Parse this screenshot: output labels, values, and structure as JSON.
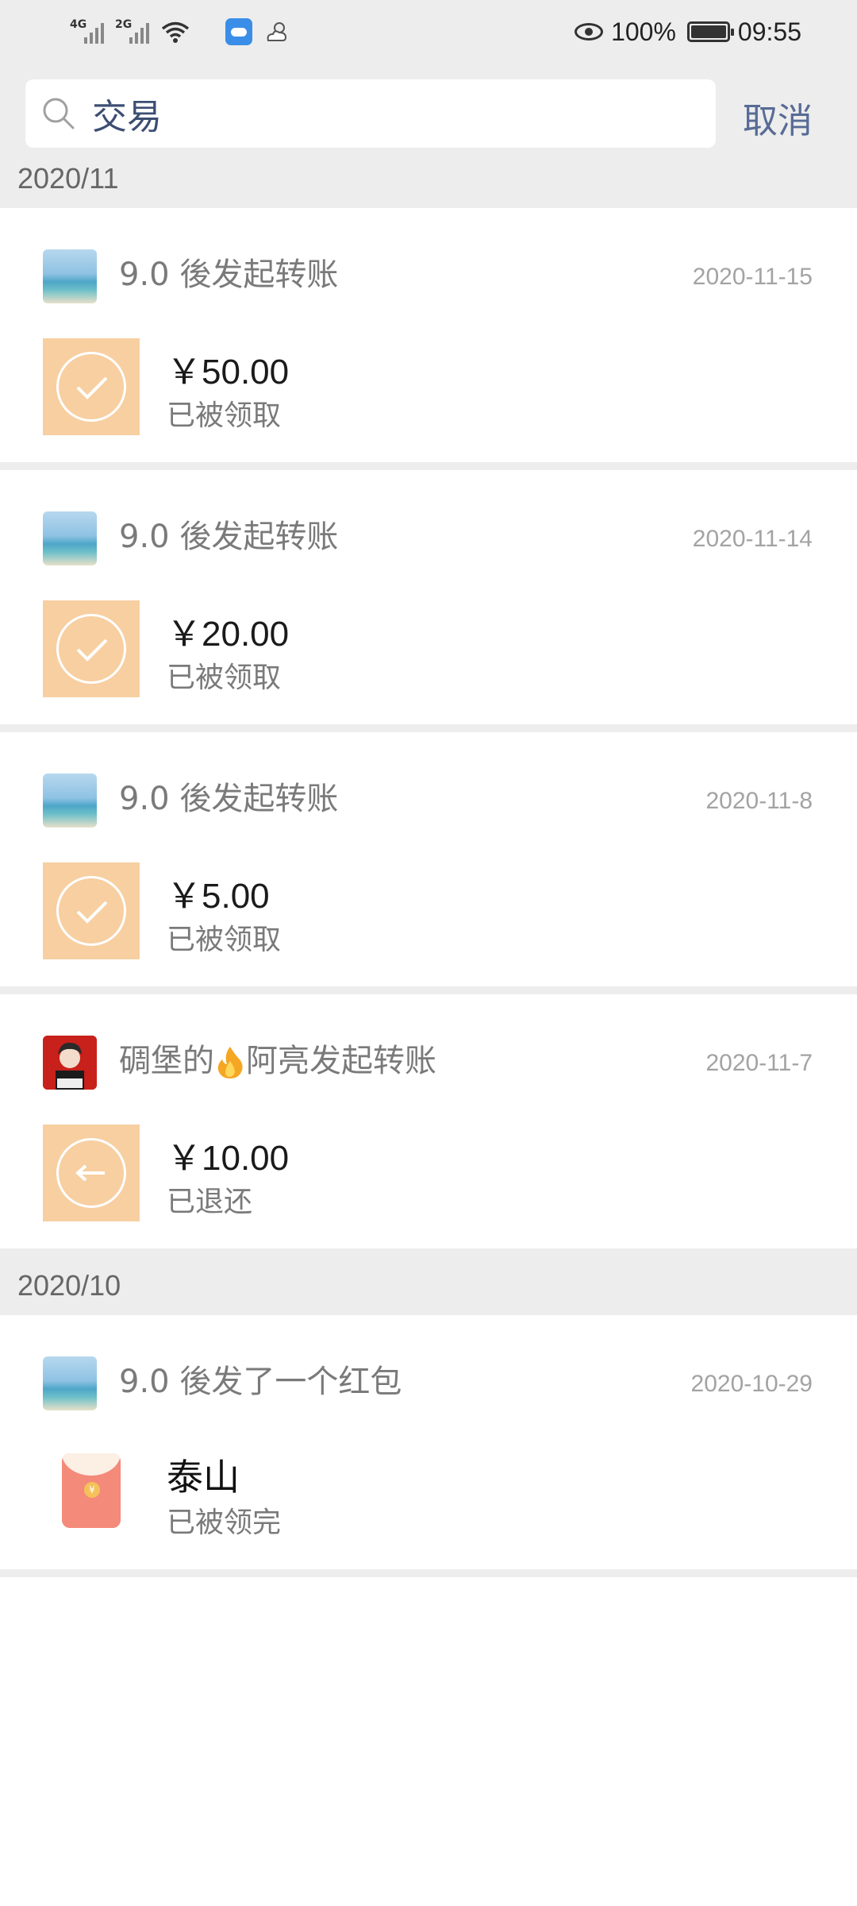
{
  "status_bar": {
    "net1": "4G",
    "net2": "2G",
    "battery_percent": "100%",
    "time": "09:55"
  },
  "search": {
    "query": "交易",
    "cancel_label": "取消"
  },
  "sections": [
    {
      "month": "2020/11",
      "items": [
        {
          "sender": "9.0 後发起转账",
          "date": "2020-11-15",
          "amount": "￥50.00",
          "status": "已被领取",
          "icon": "check-icon"
        },
        {
          "sender": "9.0 後发起转账",
          "date": "2020-11-14",
          "amount": "￥20.00",
          "status": "已被领取",
          "icon": "check-icon"
        },
        {
          "sender": "9.0 後发起转账",
          "date": "2020-11-8",
          "amount": "￥5.00",
          "status": "已被领取",
          "icon": "check-icon"
        },
        {
          "sender_prefix": "碉堡的",
          "sender_suffix": "阿亮发起转账",
          "date": "2020-11-7",
          "amount": "￥10.00",
          "status": "已退还",
          "icon": "return-arrow-icon"
        }
      ]
    },
    {
      "month": "2020/10",
      "items": [
        {
          "sender": "9.0 後发了一个红包",
          "date": "2020-10-29",
          "name": "泰山",
          "status": "已被领完",
          "icon": "red-packet-icon"
        }
      ]
    }
  ],
  "colors": {
    "background": "#ededed",
    "link": "#576b95",
    "transfer_icon": "#f7cfa1",
    "red_packet": "#f38a7a"
  }
}
